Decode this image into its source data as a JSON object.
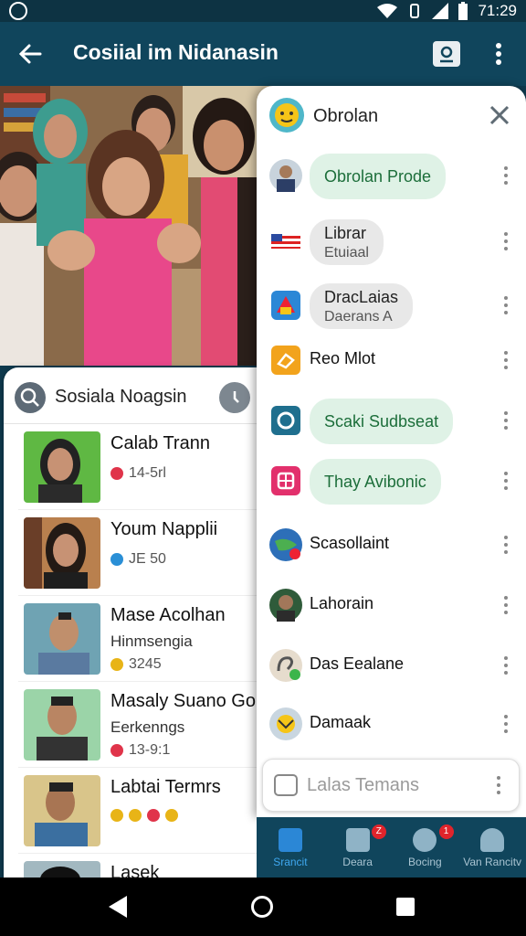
{
  "status_bar": {
    "time": "71:29"
  },
  "app_bar": {
    "title": "Cosiial im Nidanasin"
  },
  "left_panel": {
    "title": "Sosiala Noagsin",
    "contacts": [
      {
        "name": "Calab Trann",
        "meta": "14-5rl",
        "meta_color": "#e0344a"
      },
      {
        "name": "Youm Napplii",
        "meta": "JE 50",
        "meta_color": "#2a8fd6"
      },
      {
        "name": "Mase Acolhan",
        "sub": "Hinmsengia",
        "meta": "3245",
        "meta_color": "#e8b417"
      },
      {
        "name": "Masaly Suano Gola",
        "sub": "Eerkenngs",
        "meta": "13-9:1",
        "meta_color": "#e0344a"
      },
      {
        "name": "Labtai Termrs",
        "meta": "",
        "meta_color": "#e8b417"
      },
      {
        "name": "Lasek",
        "meta": "",
        "meta_color": "#e0344a"
      }
    ]
  },
  "right_panel": {
    "title": "Obrolan",
    "chats": [
      {
        "line1": "Obrolan Prode",
        "style": "green"
      },
      {
        "line1": "Librar",
        "line2": "Etuiaal",
        "style": "gray"
      },
      {
        "line1": "DracLaias",
        "line2": "Daerans A",
        "style": "gray"
      },
      {
        "line1": "Reo Mlot",
        "style": "plain"
      },
      {
        "line1": "Scaki Sudbseat",
        "style": "green"
      },
      {
        "line1": "Thay Avibonic",
        "style": "green"
      },
      {
        "line1": "Scasollaint",
        "style": "plain"
      },
      {
        "line1": "Lahorain",
        "style": "plain"
      },
      {
        "line1": "Das Eealane",
        "style": "plain"
      },
      {
        "line1": "Damaak",
        "style": "plain"
      }
    ],
    "search_placeholder": "Lalas Temans"
  },
  "bottom_nav": {
    "items": [
      {
        "label": "Srancit",
        "active": true
      },
      {
        "label": "Deara",
        "badge": "Z"
      },
      {
        "label": "Bocing",
        "badge": "1"
      },
      {
        "label": "Van Rancitv"
      }
    ]
  },
  "colors": {
    "app_bar": "#10455c",
    "status_bar": "#0d3343",
    "green_bubble": "#dff2e6",
    "gray_bubble": "#e8e8e8",
    "accent": "#2b87d6"
  }
}
